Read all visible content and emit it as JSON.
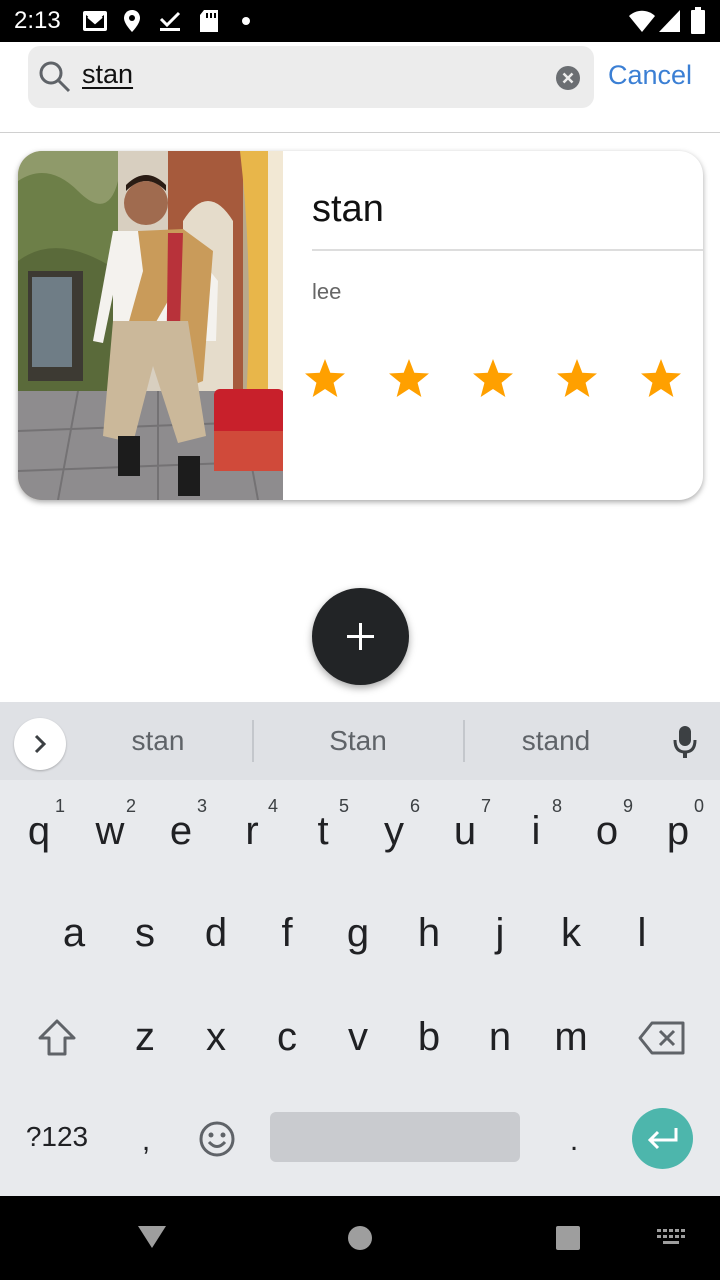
{
  "status_bar": {
    "time": "2:13"
  },
  "search": {
    "query": "stan",
    "cancel_label": "Cancel"
  },
  "card": {
    "title": "stan",
    "subtitle": "lee",
    "rating": 5,
    "rating_max": 5
  },
  "colors": {
    "accent": "#3b7fd4",
    "star": "#ffa000",
    "fab": "#222426",
    "enter_key": "#4db6ac"
  },
  "keyboard": {
    "suggestions": [
      "stan",
      "Stan",
      "stand"
    ],
    "row1": [
      "q",
      "w",
      "e",
      "r",
      "t",
      "y",
      "u",
      "i",
      "o",
      "p"
    ],
    "row1_hints": [
      "1",
      "2",
      "3",
      "4",
      "5",
      "6",
      "7",
      "8",
      "9",
      "0"
    ],
    "row2": [
      "a",
      "s",
      "d",
      "f",
      "g",
      "h",
      "j",
      "k",
      "l"
    ],
    "row3": [
      "z",
      "x",
      "c",
      "v",
      "b",
      "n",
      "m"
    ],
    "symbols_label": "?123",
    "comma": ",",
    "period": "."
  }
}
